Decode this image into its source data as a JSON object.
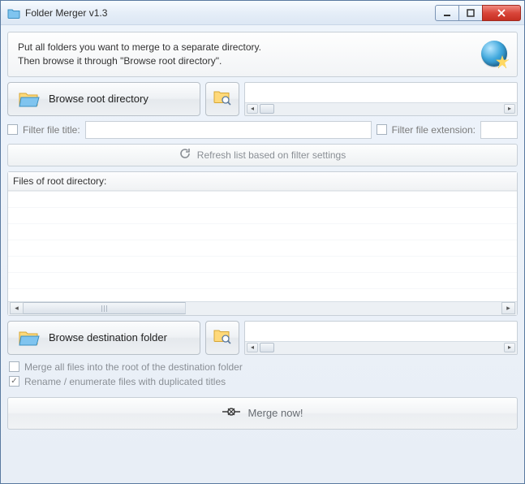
{
  "titlebar": {
    "title": "Folder Merger v1.3"
  },
  "info": {
    "line1": "Put all folders you want to merge to a separate directory.",
    "line2": "Then browse it through \"Browse root directory\"."
  },
  "browseRoot": {
    "label": "Browse root directory"
  },
  "filter": {
    "titleLabel": "Filter file title:",
    "titleValue": "",
    "extLabel": "Filter file extension:",
    "extValue": ""
  },
  "refresh": {
    "label": "Refresh list based on filter settings"
  },
  "filesHeader": "Files of root directory:",
  "browseDest": {
    "label": "Browse destination folder"
  },
  "options": {
    "mergeAll": {
      "label": "Merge all files into the root of the destination folder",
      "checked": false
    },
    "rename": {
      "label": "Rename / enumerate files with duplicated titles",
      "checked": true
    }
  },
  "merge": {
    "label": "Merge now!"
  }
}
